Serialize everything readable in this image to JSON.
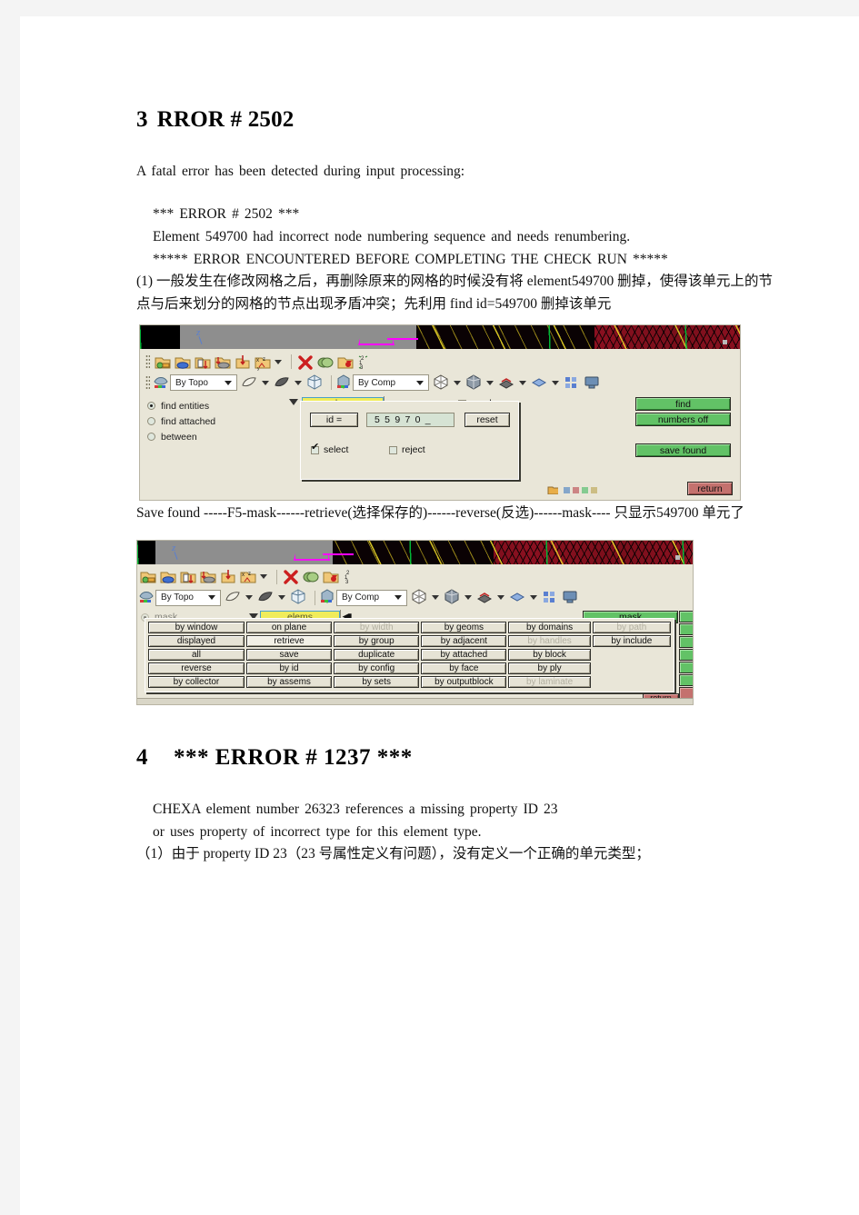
{
  "document": {
    "sections": [
      {
        "id": "sec3",
        "number": "3",
        "title": "RROR # 2502",
        "intro": "A fatal error has been detected during input processing:",
        "error_lines": [
          "*** ERROR # 2502 ***",
          "Element        549700 had incorrect node numbering sequence and needs renumbering.",
          "***** ERROR ENCOUNTERED BEFORE COMPLETING THE CHECK RUN *****"
        ],
        "note1": "(1) 一般发生在修改网格之后，再删除原来的网格的时候没有将 element549700 删掉，使得该单元上的节点与后来划分的网格的节点出现矛盾冲突；先利用 find id=549700 删掉该单元",
        "note2": "Save found  -----F5-mask------retrieve(选择保存的)------reverse(反选)------mask---- 只显示549700 单元了"
      },
      {
        "id": "sec4",
        "number": "4",
        "title": "*** ERROR # 1237 ***",
        "body_lines": [
          "CHEXA element number 26323 references a missing property ID 23",
          "or uses property of incorrect type for this element type."
        ],
        "note1": "（1）由于 property ID 23（23 号属性定义有问题），没有定义一个正确的单元类型；"
      }
    ]
  },
  "screenshot_find": {
    "toolbar_row1_icons": [
      "create-component-icon",
      "component-icon",
      "organize-icon",
      "reflect-icon",
      "translate-icon",
      "position-icon",
      "delete-icon",
      "mask-icon",
      "find-icon",
      "renumber-icon"
    ],
    "toolbar_row2": {
      "select_mode_combo": "By Topo",
      "select_mode_icon": "by-topo-icon",
      "geom_icons": [
        "surface-icon",
        "surfaces-icon",
        "solid-icon"
      ],
      "display_combo": "By Comp",
      "display_icon": "by-comp-icon",
      "view_icons": [
        "wireframe-icon",
        "shaded-icon",
        "shaded-edges-icon",
        "transparent-icon",
        "feature-icon",
        "monitor-icon"
      ]
    },
    "mode_options": [
      {
        "label": "find entities",
        "selected": true
      },
      {
        "label": "find attached",
        "selected": false
      },
      {
        "label": "between",
        "selected": false
      }
    ],
    "entity_selector": "elems",
    "numbers_checkbox": {
      "label": "numbers",
      "checked": false
    },
    "id_button": "id =",
    "id_value": "5 5 9 7 0 _",
    "reset_button": "reset",
    "select_checkbox": {
      "label": "select",
      "checked": true
    },
    "reject_checkbox": {
      "label": "reject",
      "checked": false
    },
    "action_buttons": [
      "find",
      "numbers off",
      "save found"
    ],
    "return_button": "return"
  },
  "screenshot_mask": {
    "toolbar_row2": {
      "select_mode_combo": "By Topo",
      "display_combo": "By Comp"
    },
    "mode_label": "mask",
    "entity_selector": "elems",
    "action_label": "mask",
    "grid": [
      [
        "by window",
        "on plane",
        "by width",
        "by geoms",
        "by domains",
        "by path"
      ],
      [
        "displayed",
        "retrieve",
        "by group",
        "by adjacent",
        "by handles",
        "by include"
      ],
      [
        "all",
        "save",
        "duplicate",
        "by attached",
        "by block",
        ""
      ],
      [
        "reverse",
        "by id",
        "by config",
        "by face",
        "by ply",
        ""
      ],
      [
        "by collector",
        "by assems",
        "by sets",
        "by outputblock",
        "by laminate",
        ""
      ]
    ],
    "grid_disabled": [
      [
        false,
        false,
        true,
        false,
        false,
        true
      ],
      [
        false,
        false,
        false,
        false,
        true,
        false
      ],
      [
        false,
        false,
        false,
        false,
        false,
        false
      ],
      [
        false,
        false,
        false,
        false,
        false,
        false
      ],
      [
        false,
        false,
        false,
        false,
        true,
        false
      ]
    ],
    "grid_selected_cell": "retrieve",
    "return_button": "return"
  },
  "colors": {
    "panel_bg": "#e9e6d8",
    "green_button": "#62c266",
    "red_button": "#c4716e",
    "entity_yellow": "#f0ec5a",
    "field_green": "#d6e3d4",
    "mesh_red": "#8b1020",
    "magenta": "#ff00ff"
  }
}
